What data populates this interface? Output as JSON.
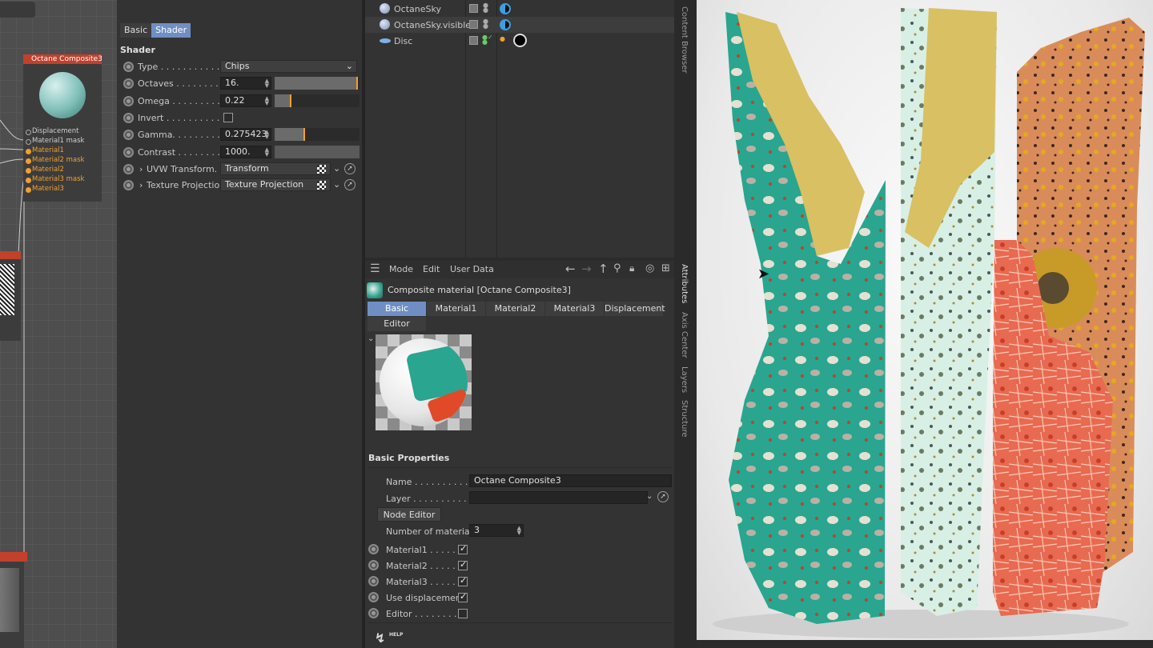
{
  "node_editor": {
    "node_title": "Octane Composite3",
    "ports": [
      "Displacement",
      "Material1 mask",
      "Material1",
      "Material2 mask",
      "Material2",
      "Material3 mask",
      "Material3"
    ]
  },
  "shader_panel": {
    "tabs": [
      "Basic",
      "Shader"
    ],
    "section_title": "Shader",
    "type": {
      "label": "Type . . . . . . . . . . .",
      "value": "Chips"
    },
    "octaves": {
      "label": "Octaves  . . . . . . . .",
      "value": "16.",
      "fraction": 0.98
    },
    "omega": {
      "label": "Omega . . . . . . . . .",
      "value": "0.22",
      "fraction": 0.2
    },
    "invert": {
      "label": "Invert . . . . . . . . . .",
      "checked": false
    },
    "gamma": {
      "label": "Gamma. . . . . . . . .",
      "value": "0.275423",
      "fraction": 0.36
    },
    "contrast": {
      "label": "Contrast  . . . . . . . .",
      "value": "1000.",
      "fraction": 0.0
    },
    "uvw": {
      "label": "UVW Transform. .",
      "value": "Transform"
    },
    "projection": {
      "label": "Texture Projection",
      "value": "Texture Projection"
    }
  },
  "object_manager": {
    "objects": [
      {
        "name": "OctaneSky"
      },
      {
        "name": "OctaneSky.visible"
      },
      {
        "name": "Disc"
      }
    ]
  },
  "side_tabs": {
    "right": [
      "Content Browser"
    ],
    "attr": [
      "Attributes",
      "Axis Center",
      "Layers",
      "Structure"
    ]
  },
  "attributes": {
    "menu": [
      "Mode",
      "Edit",
      "User Data"
    ],
    "title": "Composite material [Octane Composite3]",
    "tabs": [
      "Basic",
      "Material1",
      "Material2",
      "Material3",
      "Displacement",
      "Editor"
    ],
    "section": "Basic Properties",
    "name_label": "Name . . . . . . . . . . .",
    "name_value": "Octane Composite3",
    "layer_label": "Layer  . . . . . . . . . .",
    "node_editor_button": "Node Editor",
    "num_materials_label": "Number of materials",
    "num_materials_value": "3",
    "checks": [
      {
        "label": "Material1  . . . . .",
        "checked": true
      },
      {
        "label": "Material2  . . . . .",
        "checked": true
      },
      {
        "label": "Material3  . . . . .",
        "checked": true
      },
      {
        "label": "Use displacement",
        "checked": true
      },
      {
        "label": "Editor . . . . . . . .",
        "checked": false
      }
    ],
    "help_label": "HELP"
  },
  "colors": {
    "accent": "#6f8fc4",
    "node_red": "#c2402c",
    "orange": "#f0a030",
    "teal": "#2aa58f",
    "coral": "#e86a50"
  }
}
